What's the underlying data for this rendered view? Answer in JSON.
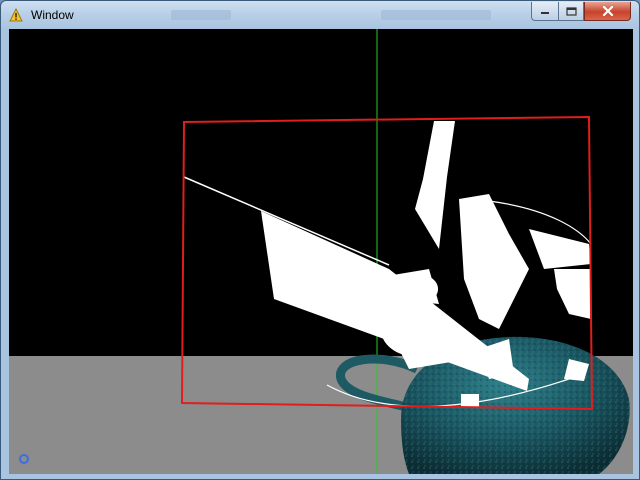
{
  "window": {
    "title": "Window",
    "title_icon": "warning-icon",
    "controls": {
      "minimize_icon": "minimize-icon",
      "maximize_icon": "maximize-icon",
      "close_icon": "close-icon"
    }
  },
  "scene": {
    "background_color": "#000000",
    "floor_color": "#8c8c8c",
    "frame_color": "#ff1a1a",
    "axis_color": "#22cc22",
    "object": "teapot",
    "object_color": "#1f5a64",
    "origin_marker_icon": "origin-marker-icon"
  }
}
